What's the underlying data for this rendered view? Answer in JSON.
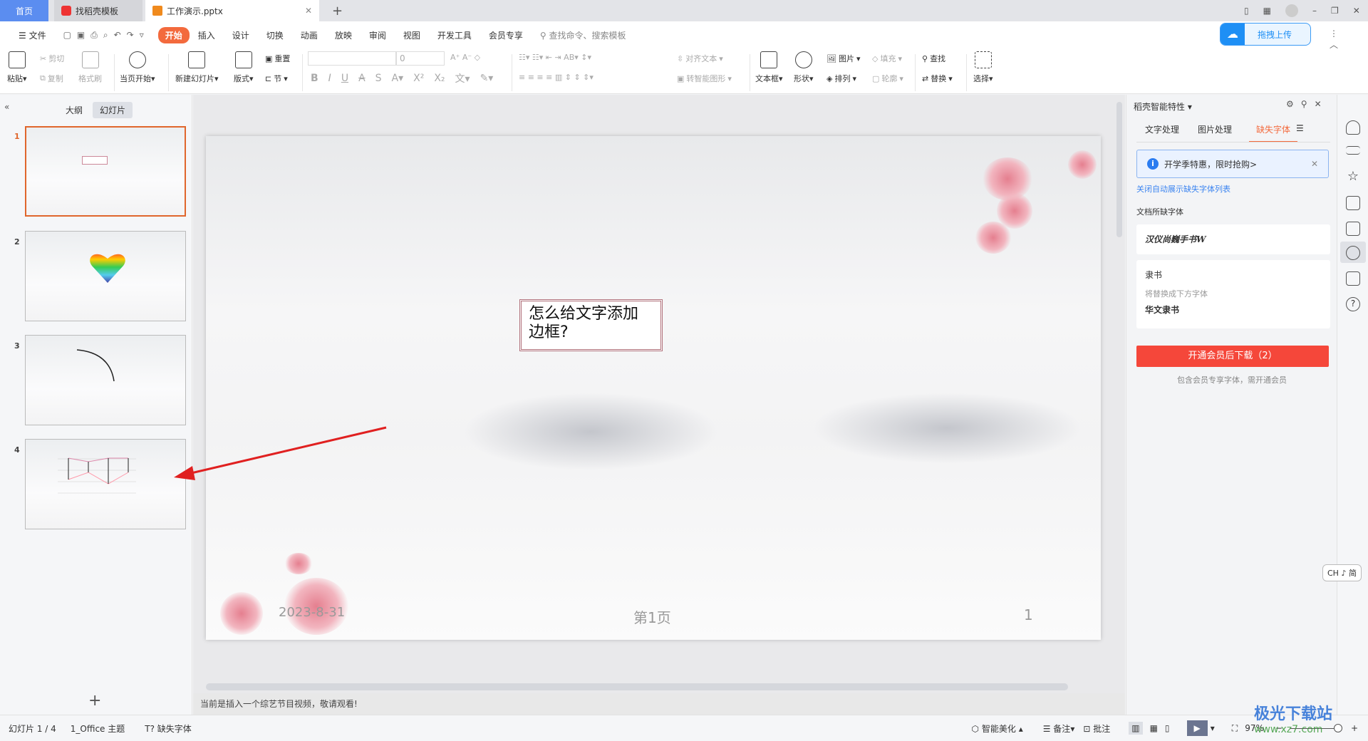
{
  "tabs": [
    {
      "label": "首页"
    },
    {
      "label": "找稻壳模板"
    },
    {
      "label": "工作演示.pptx"
    }
  ],
  "menu": {
    "file": "文件",
    "items": [
      "开始",
      "插入",
      "设计",
      "切换",
      "动画",
      "放映",
      "审阅",
      "视图",
      "开发工具",
      "会员专享"
    ],
    "search_placeholder": "查找命令、搜索模板",
    "upload": "拖拽上传"
  },
  "ribbon": {
    "paste": "粘贴",
    "cut": "剪切",
    "copy": "复制",
    "format_painter": "格式刷",
    "from_current": "当页开始",
    "new_slide": "新建幻灯片",
    "layout": "版式",
    "reset": "重置",
    "section": "节",
    "font_size": "0",
    "align_text": "对齐文本",
    "smartart": "转智能图形",
    "textbox": "文本框",
    "shape": "形状",
    "picture": "图片",
    "arrange": "排列",
    "fill": "填充",
    "outline": "轮廓",
    "find": "查找",
    "replace": "替换",
    "select": "选择"
  },
  "left_panel": {
    "tab_outline": "大纲",
    "tab_slides": "幻灯片",
    "slides": [
      {
        "num": "1"
      },
      {
        "num": "2"
      },
      {
        "num": "3"
      },
      {
        "num": "4"
      }
    ],
    "selected": 1
  },
  "slide": {
    "title": "怎么给文字添加边框?",
    "date": "2023-8-31",
    "footer": "第1页",
    "page_num": "1"
  },
  "notes": "当前是插入一个综艺节目视频，敬请观看!",
  "status": {
    "slide_count": "幻灯片 1 / 4",
    "theme": "1_Office 主题",
    "missing_font": "缺失字体",
    "beautify": "智能美化",
    "notes": "备注",
    "comment": "批注",
    "zoom": "97%"
  },
  "right_panel": {
    "title": "稻壳智能特性",
    "tabs": [
      "文字处理",
      "图片处理",
      "缺失字体"
    ],
    "active_tab": 2,
    "banner": "开学季特惠，限时抢购>",
    "close_auto": "关闭自动展示缺失字体列表",
    "section": "文档所缺字体",
    "font1": "汉仪尚巍手书W",
    "font2": "隶书",
    "replace_hint": "将替换成下方字体",
    "font2_replacement": "华文隶书",
    "download_btn": "开通会员后下载（2）",
    "download_hint": "包含会员专享字体，需开通会员"
  },
  "ime": "CH ♪ 简",
  "watermark": {
    "text": "极光下载站",
    "url": "www.xz7.com"
  },
  "colors": {
    "accent": "#f36a3d",
    "download": "#f5473a",
    "link": "#3b84f0",
    "selected_border": "#e0662c"
  }
}
